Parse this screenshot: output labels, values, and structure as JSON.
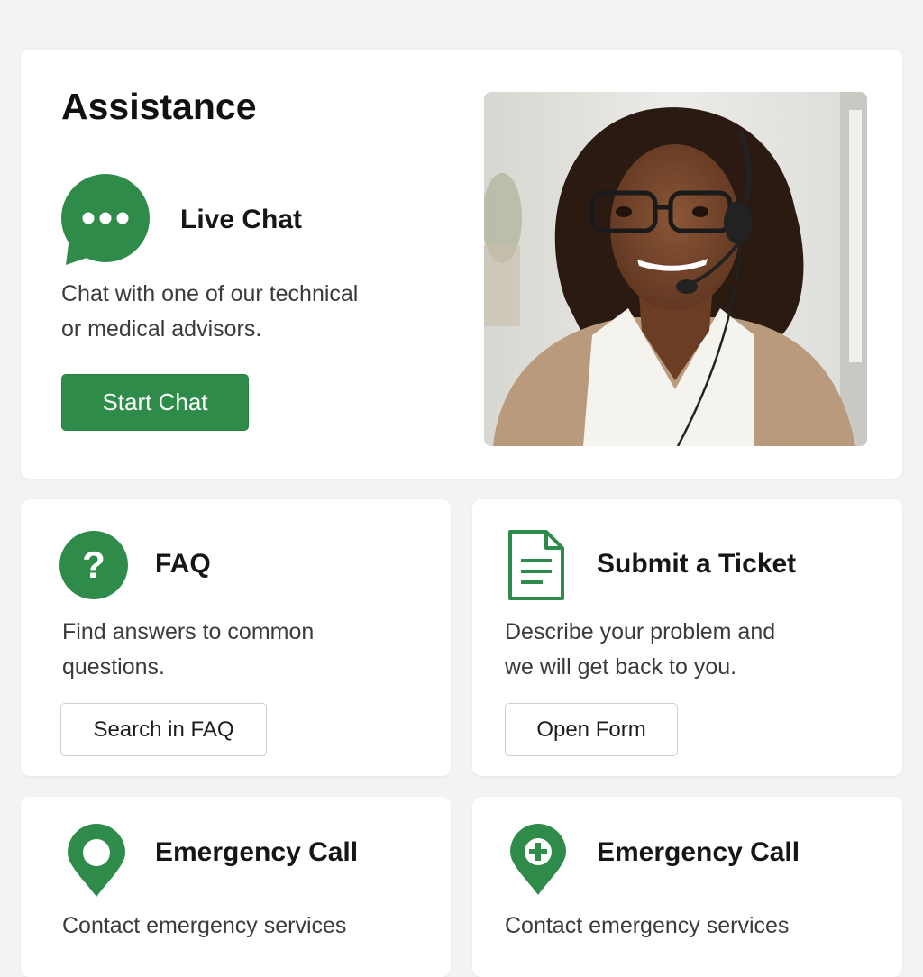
{
  "colors": {
    "accent": "#2e8b4a",
    "background": "#f3f3f3",
    "card": "#ffffff"
  },
  "hero": {
    "title": "Assistance",
    "live_chat": {
      "icon": "chat-bubble-icon",
      "title": "Live Chat",
      "description_line1": "Chat with one of our technical",
      "description_line2": "or medical advisors.",
      "button_label": "Start Chat"
    },
    "photo": "support-agent-with-headset-photo"
  },
  "faq": {
    "icon": "question-mark-icon",
    "title": "FAQ",
    "description_line1": "Find answers to common",
    "description_line2": "questions.",
    "button_label": "Search in FAQ"
  },
  "ticket": {
    "icon": "document-icon",
    "title": "Submit a Ticket",
    "description_line1": "Describe your problem and",
    "description_line2": "we will get back to you.",
    "button_label": "Open Form"
  },
  "emergency_1": {
    "icon": "location-pin-icon",
    "title": "Emergency Call",
    "description": "Contact emergency services"
  },
  "emergency_2": {
    "icon": "location-pin-plus-icon",
    "title": "Emergency Call",
    "description": "Contact emergency services"
  }
}
